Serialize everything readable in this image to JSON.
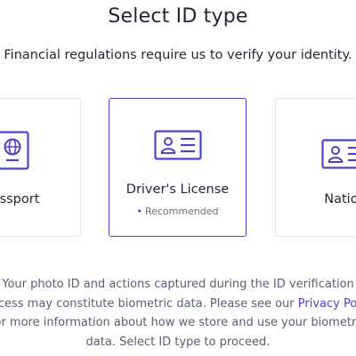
{
  "header": {
    "title": "Select ID type",
    "subtitle": "Financial regulations require us to verify your identity."
  },
  "id_options": [
    {
      "label": "Passport",
      "icon": "passport-icon",
      "selected": false
    },
    {
      "label": "Driver's License",
      "icon": "id-card-icon",
      "selected": true,
      "badge": "Recommended"
    },
    {
      "label": "National ID",
      "icon": "id-card-icon",
      "selected": false
    }
  ],
  "disclaimer": {
    "line1": "Your photo ID and actions captured during the ID verification",
    "line2_before": "process may constitute biometric data. Please see our ",
    "privacy_link": "Privacy Policy",
    "line3": "for more information about how we store and use your biometric",
    "line4": "data. Select ID type to proceed."
  },
  "colors": {
    "accent": "#4b44c9",
    "text": "#1f2430",
    "muted": "#5a6072",
    "border": "#e3e5ea"
  }
}
